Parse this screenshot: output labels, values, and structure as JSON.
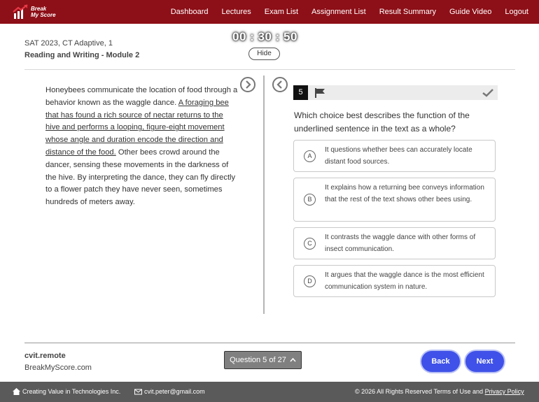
{
  "brand": {
    "logo_text_line1": "Break",
    "logo_text_line2": "My Score",
    "logo_color": "#c1121f"
  },
  "nav": {
    "items": [
      "Dashboard",
      "Lectures",
      "Exam List",
      "Assignment List",
      "Result Summary",
      "Guide Video",
      "Logout"
    ]
  },
  "header": {
    "exam_name": "SAT 2023, CT Adaptive, 1",
    "module": "Reading and Writing - Module 2",
    "timer": "00 : 30 : 50",
    "hide_label": "Hide"
  },
  "passage": {
    "before": "Honeybees communicate the location of food through a behavior known as the waggle dance. ",
    "underlined": "A foraging bee that has found a rich source of nectar returns to the hive and performs a looping, figure-eight movement whose angle and duration encode the direction and distance of the food.",
    "after": " Other bees crowd around the dancer, sensing these movements in the darkness of the hive. By interpreting the dance, they can fly directly to a flower patch they have never seen, sometimes hundreds of meters away."
  },
  "question": {
    "number": "5",
    "text": "Which choice best describes the function of the underlined sentence in the text as a whole?",
    "choices": [
      {
        "letter": "A",
        "text": "It questions whether bees can accurately locate distant food sources."
      },
      {
        "letter": "B",
        "text": "It explains how a returning bee conveys information that the rest of the text shows other bees using."
      },
      {
        "letter": "C",
        "text": "It contrasts the waggle dance with other forms of insect communication."
      },
      {
        "letter": "D",
        "text": "It argues that the waggle dance is the most efficient communication system in nature."
      }
    ]
  },
  "footer": {
    "username": "cvit.remote",
    "site": "BreakMyScore.com",
    "question_nav": "Question 5 of 27",
    "back_label": "Back",
    "next_label": "Next"
  },
  "bottom_bar": {
    "company": "Creating Value in Technologies Inc.",
    "email": "cvit.peter@gmail.com",
    "copyright": "© 2026 All Rights Reserved Terms of Use and ",
    "privacy": "Privacy Policy"
  },
  "colors": {
    "topbar": "#8d0f17",
    "button": "#3f51e8",
    "bottombar": "#5a5a5a"
  }
}
